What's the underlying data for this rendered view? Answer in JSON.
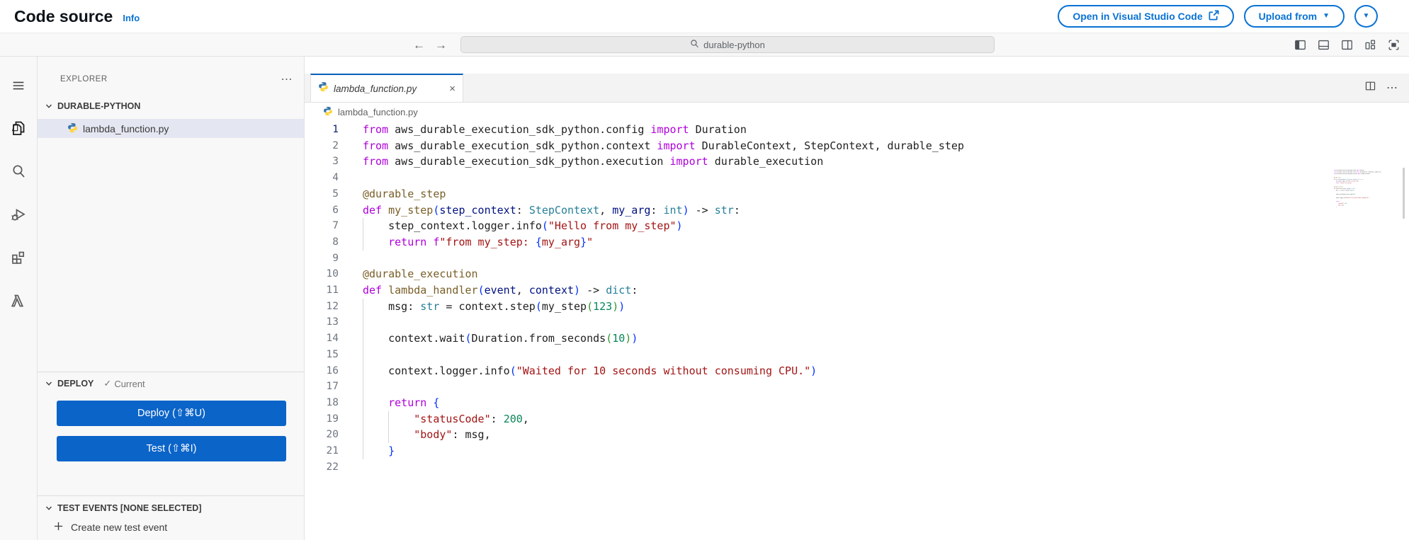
{
  "header": {
    "title": "Code source",
    "info": "Info",
    "open_vscode": "Open in Visual Studio Code",
    "upload_from": "Upload from",
    "icons": [
      "external-link-icon",
      "caret-down-icon"
    ]
  },
  "toolbar": {
    "search_value": "durable-python",
    "back": "←",
    "forward": "→",
    "window_icons": [
      "layout-sidebar-left-icon",
      "layout-panel-icon",
      "layout-sidebar-right-icon",
      "customize-layout-icon",
      "fullscreen-icon"
    ]
  },
  "activity_bar": {
    "icons": [
      "menu-icon",
      "files-icon",
      "search-icon",
      "run-debug-icon",
      "extensions-icon",
      "aws-lambda-icon"
    ]
  },
  "explorer": {
    "title": "EXPLORER",
    "actions": "⋯",
    "folder": "DURABLE-PYTHON",
    "file": "lambda_function.py",
    "deploy": {
      "title": "DEPLOY",
      "check": "✓",
      "status": "Current",
      "deploy_button": "Deploy (⇧⌘U)",
      "test_button": "Test (⇧⌘I)"
    },
    "test_events": {
      "title": "TEST EVENTS [NONE SELECTED]",
      "create": "Create new test event"
    }
  },
  "editor": {
    "tab": "lambda_function.py",
    "tab_close": "×",
    "breadcrumb": "lambda_function.py",
    "actions": "⋯",
    "code": {
      "language": "python",
      "token_colors": {
        "k": "#af00db",
        "d": "#1f1f1f",
        "fn": "#795e26",
        "p": "#001080",
        "t": "#267f99",
        "s": "#a31515",
        "n": "#098658",
        "b1": "#0431fa",
        "b2": "#319331"
      },
      "lines": [
        {
          "g": 0,
          "t": [
            [
              "k",
              "from"
            ],
            [
              "d",
              " aws_durable_execution_sdk_python.config "
            ],
            [
              "k",
              "import"
            ],
            [
              "d",
              " Duration"
            ]
          ]
        },
        {
          "g": 0,
          "t": [
            [
              "k",
              "from"
            ],
            [
              "d",
              " aws_durable_execution_sdk_python.context "
            ],
            [
              "k",
              "import"
            ],
            [
              "d",
              " DurableContext, StepContext, durable_step"
            ]
          ]
        },
        {
          "g": 0,
          "t": [
            [
              "k",
              "from"
            ],
            [
              "d",
              " aws_durable_execution_sdk_python.execution "
            ],
            [
              "k",
              "import"
            ],
            [
              "d",
              " durable_execution"
            ]
          ]
        },
        {
          "g": 0,
          "t": []
        },
        {
          "g": 0,
          "t": [
            [
              "fn",
              "@durable_step"
            ]
          ]
        },
        {
          "g": 0,
          "t": [
            [
              "k",
              "def"
            ],
            [
              "d",
              " "
            ],
            [
              "fn",
              "my_step"
            ],
            [
              "b1",
              "("
            ],
            [
              "p",
              "step_context"
            ],
            [
              "d",
              ": "
            ],
            [
              "t",
              "StepContext"
            ],
            [
              "d",
              ", "
            ],
            [
              "p",
              "my_arg"
            ],
            [
              "d",
              ": "
            ],
            [
              "t",
              "int"
            ],
            [
              "b1",
              ")"
            ],
            [
              "d",
              " -> "
            ],
            [
              "t",
              "str"
            ],
            [
              "d",
              ":"
            ]
          ]
        },
        {
          "g": 1,
          "t": [
            [
              "d",
              "    step_context.logger.info"
            ],
            [
              "b1",
              "("
            ],
            [
              "s",
              "\"Hello from my_step\""
            ],
            [
              "b1",
              ")"
            ]
          ]
        },
        {
          "g": 1,
          "t": [
            [
              "d",
              "    "
            ],
            [
              "k",
              "return"
            ],
            [
              "d",
              " "
            ],
            [
              "k",
              "f"
            ],
            [
              "s",
              "\"from my_step: "
            ],
            [
              "b1",
              "{"
            ],
            [
              "s",
              "my_arg"
            ],
            [
              "b1",
              "}"
            ],
            [
              "s",
              "\""
            ]
          ]
        },
        {
          "g": 0,
          "t": []
        },
        {
          "g": 0,
          "t": [
            [
              "fn",
              "@durable_execution"
            ]
          ]
        },
        {
          "g": 0,
          "t": [
            [
              "k",
              "def"
            ],
            [
              "d",
              " "
            ],
            [
              "fn",
              "lambda_handler"
            ],
            [
              "b1",
              "("
            ],
            [
              "p",
              "event"
            ],
            [
              "d",
              ", "
            ],
            [
              "p",
              "context"
            ],
            [
              "b1",
              ")"
            ],
            [
              "d",
              " -> "
            ],
            [
              "t",
              "dict"
            ],
            [
              "d",
              ":"
            ]
          ]
        },
        {
          "g": 1,
          "t": [
            [
              "d",
              "    msg: "
            ],
            [
              "t",
              "str"
            ],
            [
              "d",
              " = context.step"
            ],
            [
              "b1",
              "("
            ],
            [
              "d",
              "my_step"
            ],
            [
              "b2",
              "("
            ],
            [
              "n",
              "123"
            ],
            [
              "b2",
              ")"
            ],
            [
              "b1",
              ")"
            ]
          ]
        },
        {
          "g": 1,
          "t": []
        },
        {
          "g": 1,
          "t": [
            [
              "d",
              "    context.wait"
            ],
            [
              "b1",
              "("
            ],
            [
              "d",
              "Duration.from_seconds"
            ],
            [
              "b2",
              "("
            ],
            [
              "n",
              "10"
            ],
            [
              "b2",
              ")"
            ],
            [
              "b1",
              ")"
            ]
          ]
        },
        {
          "g": 1,
          "t": []
        },
        {
          "g": 1,
          "t": [
            [
              "d",
              "    context.logger.info"
            ],
            [
              "b1",
              "("
            ],
            [
              "s",
              "\"Waited for 10 seconds without consuming CPU.\""
            ],
            [
              "b1",
              ")"
            ]
          ]
        },
        {
          "g": 1,
          "t": []
        },
        {
          "g": 1,
          "t": [
            [
              "d",
              "    "
            ],
            [
              "k",
              "return"
            ],
            [
              "d",
              " "
            ],
            [
              "b1",
              "{"
            ]
          ]
        },
        {
          "g": 2,
          "t": [
            [
              "d",
              "        "
            ],
            [
              "s",
              "\"statusCode\""
            ],
            [
              "d",
              ": "
            ],
            [
              "n",
              "200"
            ],
            [
              "d",
              ","
            ]
          ]
        },
        {
          "g": 2,
          "t": [
            [
              "d",
              "        "
            ],
            [
              "s",
              "\"body\""
            ],
            [
              "d",
              ": msg,"
            ]
          ]
        },
        {
          "g": 1,
          "t": [
            [
              "d",
              "    "
            ],
            [
              "b1",
              "}"
            ]
          ]
        },
        {
          "g": 0,
          "t": []
        }
      ]
    }
  },
  "colors": {
    "aws_blue": "#0972d3",
    "vscode_button_blue": "#0b64c8",
    "active_tab_border": "#005fb8",
    "selection_bg": "#e4e6f1"
  }
}
